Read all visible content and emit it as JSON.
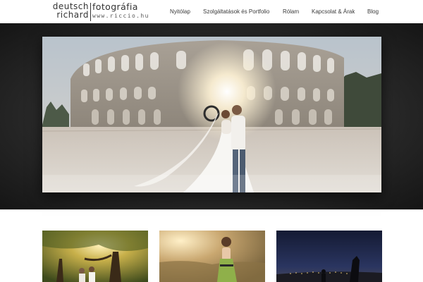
{
  "logo": {
    "word1": "deutsch",
    "word2": "richard",
    "word3": "fotográfia",
    "url": "www.riccio.hu"
  },
  "nav": {
    "items": [
      {
        "label": "Nyitólap"
      },
      {
        "label": "Szolgáltatások és Portfolio"
      },
      {
        "label": "Rólam"
      },
      {
        "label": "Kapcsolat & Árak"
      },
      {
        "label": "Blog"
      }
    ]
  },
  "hero": {
    "photo": "wedding-couple-at-colosseum-photo"
  },
  "gallery": {
    "thumbs": [
      {
        "photo": "couple-under-tree-photo"
      },
      {
        "photo": "woman-in-green-dress-field-photo"
      },
      {
        "photo": "night-city-silhouette-photo"
      }
    ]
  },
  "colors": {
    "header_bg": "#ffffff",
    "hero_band_dark": "#1a1a1a",
    "nav_text": "#3a3a3a",
    "page_bg": "#ffffff"
  }
}
